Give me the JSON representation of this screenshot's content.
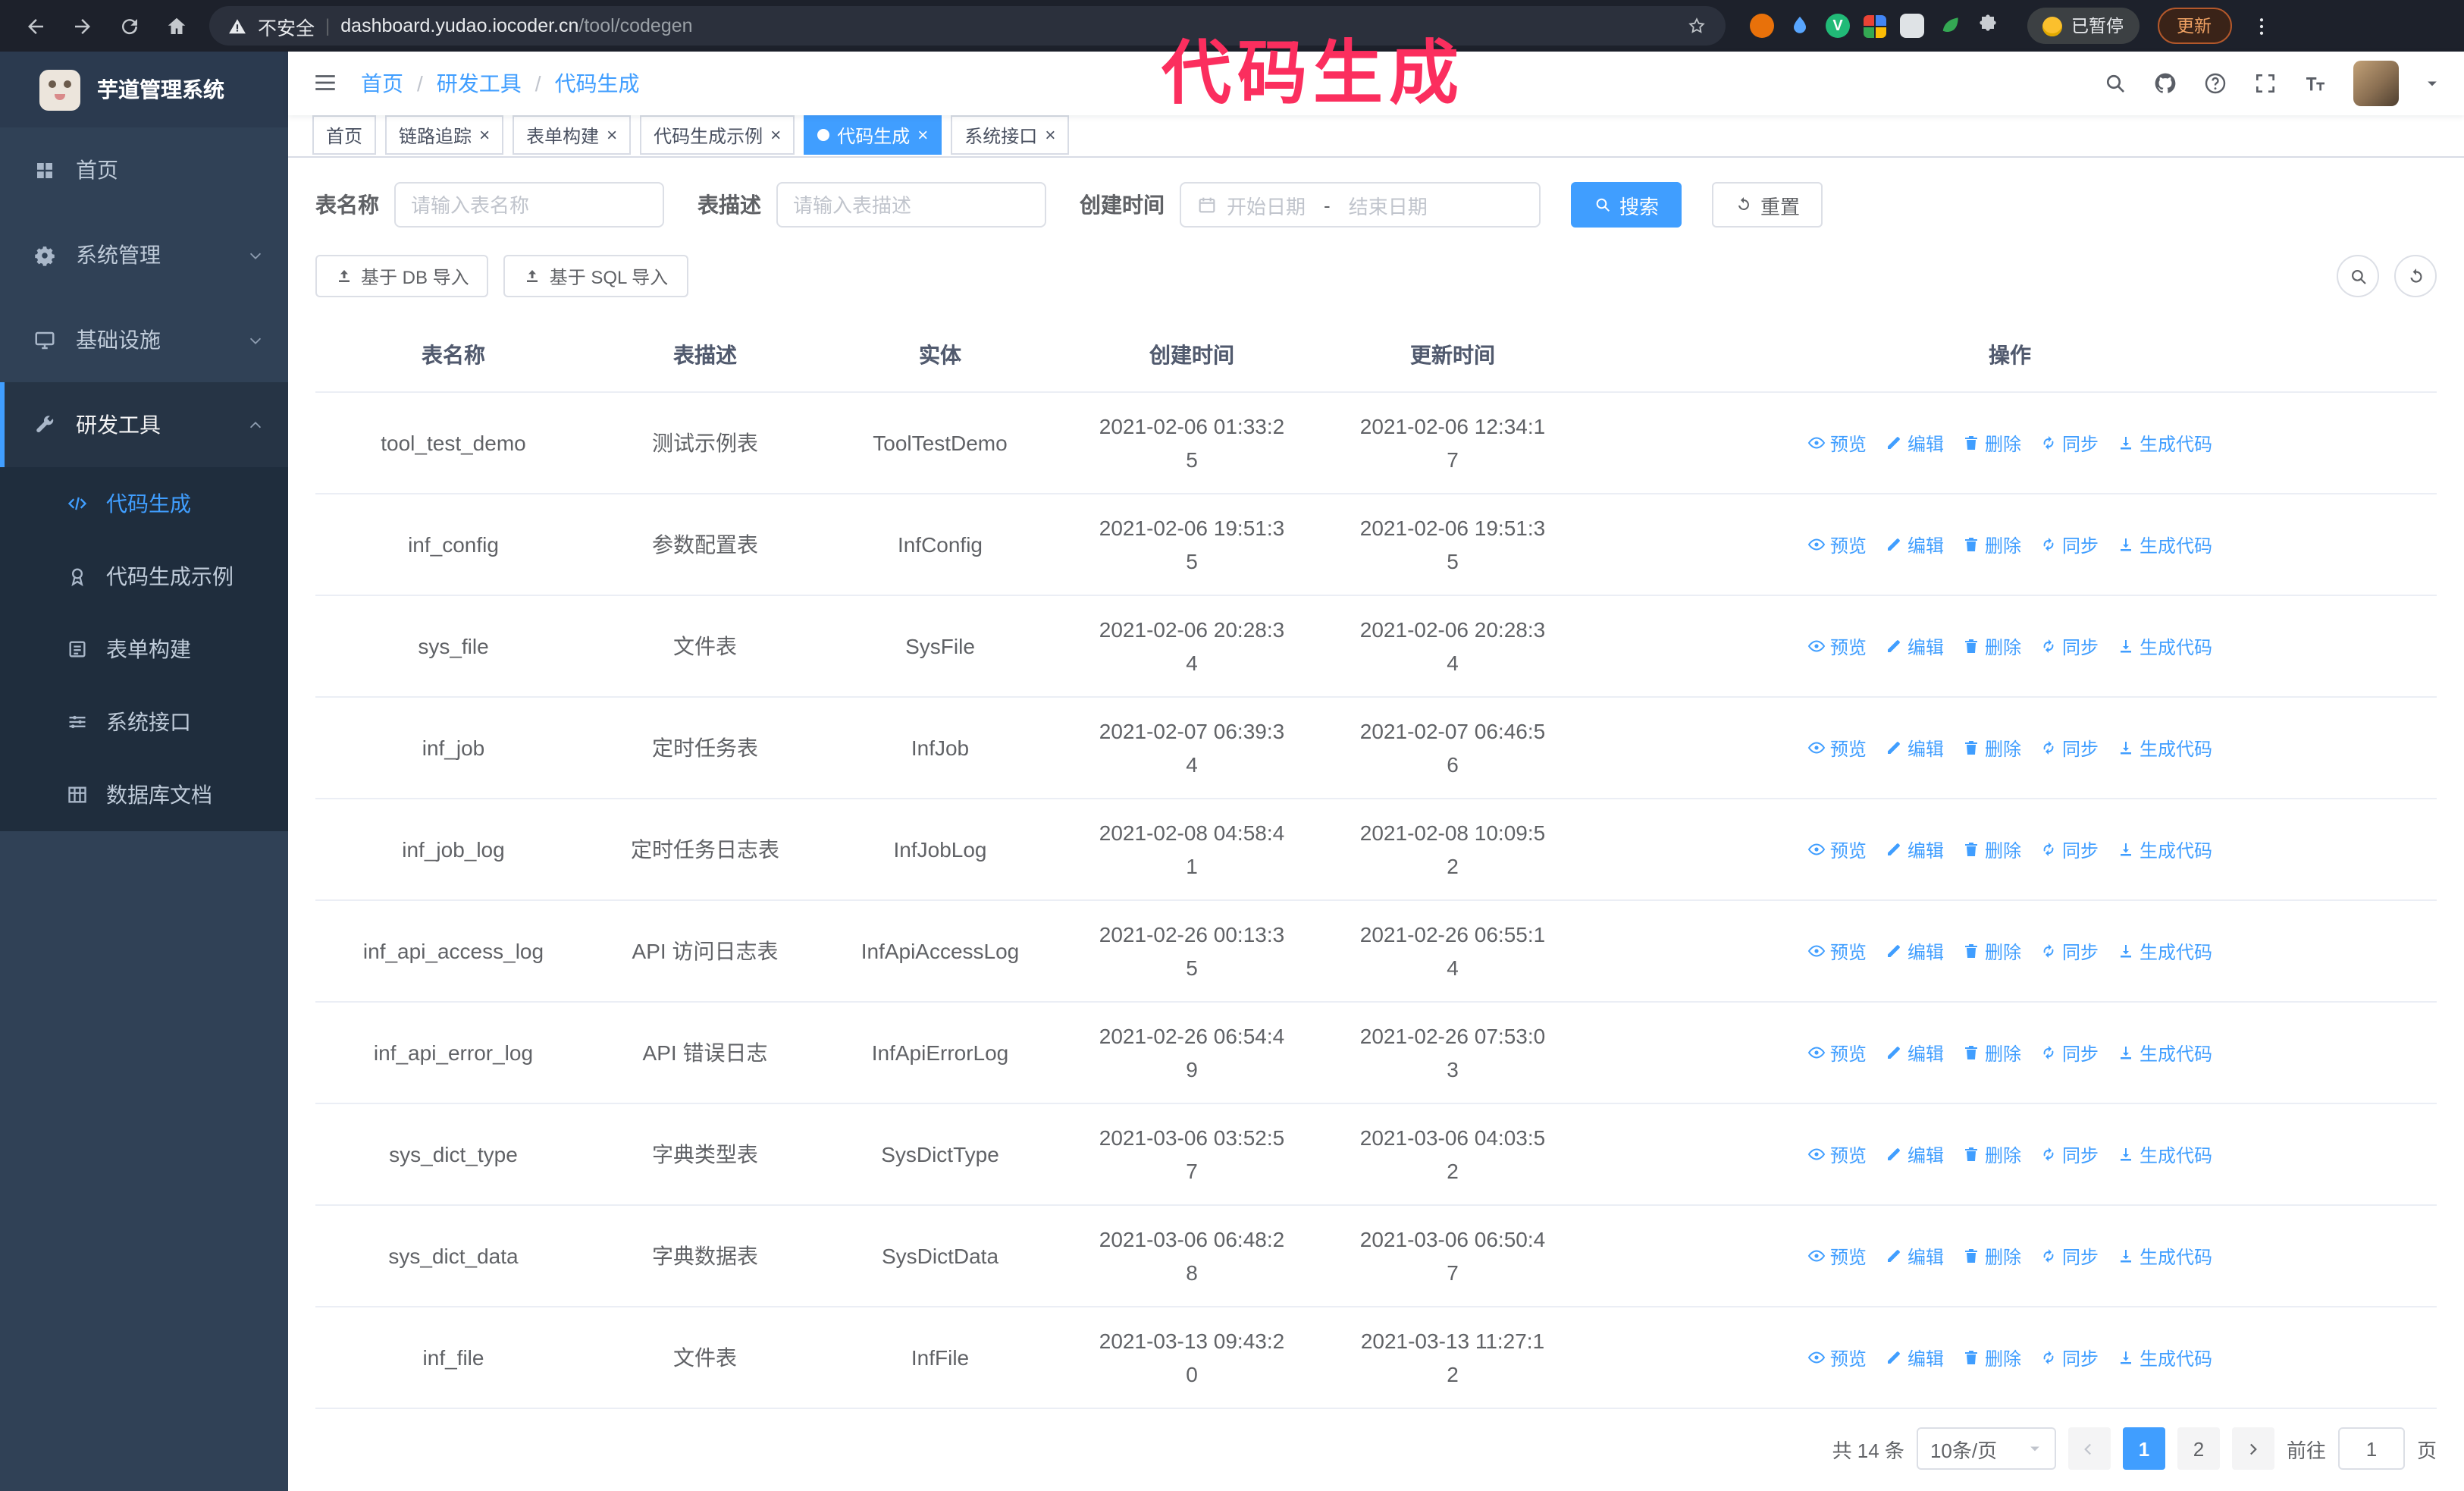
{
  "theme": {
    "accent": "#409eff",
    "sidebar_bg": "#304156",
    "submenu_bg": "#1f2d3d",
    "annotation_color": "#fb2e5e"
  },
  "annotation": {
    "text": "代码生成"
  },
  "browser": {
    "security_label": "不安全",
    "url_host": "dashboard.yudao.iocoder.cn",
    "url_path": "/tool/codegen",
    "paused_badge": "已暂停",
    "update_button": "更新",
    "extensions": [
      {
        "name": "extension-orange-circle",
        "type": "circle",
        "color": "#e8710a"
      },
      {
        "name": "extension-water-drop",
        "type": "drop",
        "color": "#58a6ff"
      },
      {
        "name": "extension-vue-devtools",
        "type": "circle-v",
        "color": "#21ba77",
        "glyph": "V"
      },
      {
        "name": "extension-color-grid",
        "type": "grid4",
        "colors": [
          "#ea4335",
          "#4285f4",
          "#34a853",
          "#fbbc05"
        ]
      },
      {
        "name": "extension-gray-square",
        "type": "square",
        "color": "#dfe3e6"
      },
      {
        "name": "extension-green-leaf",
        "type": "leaf",
        "color": "#34a853"
      },
      {
        "name": "extensions-puzzle",
        "type": "puzzle",
        "color": "#c9cdd2"
      }
    ]
  },
  "app": {
    "title": "芋道管理系统"
  },
  "sidebar": {
    "items": [
      {
        "id": "home",
        "label": "首页",
        "icon": "grid"
      },
      {
        "id": "system-mgmt",
        "label": "系统管理",
        "icon": "gear",
        "chevron": "down"
      },
      {
        "id": "infrastructure",
        "label": "基础设施",
        "icon": "monitor",
        "chevron": "down"
      },
      {
        "id": "dev-tools",
        "label": "研发工具",
        "icon": "wrench",
        "chevron": "up",
        "active": true
      }
    ],
    "subitems": [
      {
        "id": "codegen",
        "label": "代码生成",
        "icon": "code",
        "active": true
      },
      {
        "id": "codegen-example",
        "label": "代码生成示例",
        "icon": "medal"
      },
      {
        "id": "form-builder",
        "label": "表单构建",
        "icon": "form"
      },
      {
        "id": "system-api",
        "label": "系统接口",
        "icon": "sliders"
      },
      {
        "id": "db-doc",
        "label": "数据库文档",
        "icon": "table"
      }
    ]
  },
  "header": {
    "breadcrumb": [
      "首页",
      "研发工具",
      "代码生成"
    ],
    "icons": [
      {
        "id": "search",
        "icon": "search"
      },
      {
        "id": "github",
        "icon": "github"
      },
      {
        "id": "docs",
        "icon": "question"
      },
      {
        "id": "fullscreen",
        "icon": "fullscreen"
      },
      {
        "id": "font-size",
        "icon": "fontsize"
      }
    ]
  },
  "tabs": [
    {
      "id": "home",
      "label": "首页",
      "closable": false,
      "active": false
    },
    {
      "id": "tracer",
      "label": "链路追踪",
      "closable": true,
      "active": false
    },
    {
      "id": "form-builder",
      "label": "表单构建",
      "closable": true,
      "active": false
    },
    {
      "id": "codegen-example",
      "label": "代码生成示例",
      "closable": true,
      "active": false
    },
    {
      "id": "codegen",
      "label": "代码生成",
      "closable": true,
      "active": true
    },
    {
      "id": "system-api",
      "label": "系统接口",
      "closable": true,
      "active": false
    }
  ],
  "filters": {
    "table_name_label": "表名称",
    "table_name_placeholder": "请输入表名称",
    "table_desc_label": "表描述",
    "table_desc_placeholder": "请输入表描述",
    "create_time_label": "创建时间",
    "date_start_placeholder": "开始日期",
    "date_separator": "-",
    "date_end_placeholder": "结束日期",
    "search_button": "搜索",
    "reset_button": "重置"
  },
  "toolbar": {
    "import_db": "基于 DB 导入",
    "import_sql": "基于 SQL 导入"
  },
  "table": {
    "columns": [
      "表名称",
      "表描述",
      "实体",
      "创建时间",
      "更新时间",
      "操作"
    ],
    "row_actions": [
      {
        "id": "preview",
        "label": "预览",
        "icon": "eye"
      },
      {
        "id": "edit",
        "label": "编辑",
        "icon": "edit"
      },
      {
        "id": "delete",
        "label": "删除",
        "icon": "trash"
      },
      {
        "id": "sync",
        "label": "同步",
        "icon": "sync"
      },
      {
        "id": "generate-code",
        "label": "生成代码",
        "icon": "download"
      }
    ],
    "rows": [
      {
        "name": "tool_test_demo",
        "desc": "测试示例表",
        "entity": "ToolTestDemo",
        "created": "2021-02-06 01:33:25",
        "updated": "2021-02-06 12:34:17"
      },
      {
        "name": "inf_config",
        "desc": "参数配置表",
        "entity": "InfConfig",
        "created": "2021-02-06 19:51:35",
        "updated": "2021-02-06 19:51:35"
      },
      {
        "name": "sys_file",
        "desc": "文件表",
        "entity": "SysFile",
        "created": "2021-02-06 20:28:34",
        "updated": "2021-02-06 20:28:34"
      },
      {
        "name": "inf_job",
        "desc": "定时任务表",
        "entity": "InfJob",
        "created": "2021-02-07 06:39:34",
        "updated": "2021-02-07 06:46:56"
      },
      {
        "name": "inf_job_log",
        "desc": "定时任务日志表",
        "entity": "InfJobLog",
        "created": "2021-02-08 04:58:41",
        "updated": "2021-02-08 10:09:52"
      },
      {
        "name": "inf_api_access_log",
        "desc": "API 访问日志表",
        "entity": "InfApiAccessLog",
        "created": "2021-02-26 00:13:35",
        "updated": "2021-02-26 06:55:14"
      },
      {
        "name": "inf_api_error_log",
        "desc": "API 错误日志",
        "entity": "InfApiErrorLog",
        "created": "2021-02-26 06:54:49",
        "updated": "2021-02-26 07:53:03"
      },
      {
        "name": "sys_dict_type",
        "desc": "字典类型表",
        "entity": "SysDictType",
        "created": "2021-03-06 03:52:57",
        "updated": "2021-03-06 04:03:52"
      },
      {
        "name": "sys_dict_data",
        "desc": "字典数据表",
        "entity": "SysDictData",
        "created": "2021-03-06 06:48:28",
        "updated": "2021-03-06 06:50:47"
      },
      {
        "name": "inf_file",
        "desc": "文件表",
        "entity": "InfFile",
        "created": "2021-03-13 09:43:20",
        "updated": "2021-03-13 11:27:12"
      }
    ]
  },
  "pagination": {
    "total_label": "共 14 条",
    "page_size_label": "10条/页",
    "pages": [
      "1",
      "2"
    ],
    "active_page": "1",
    "goto_prefix": "前往",
    "goto_value": "1",
    "goto_suffix": "页"
  }
}
